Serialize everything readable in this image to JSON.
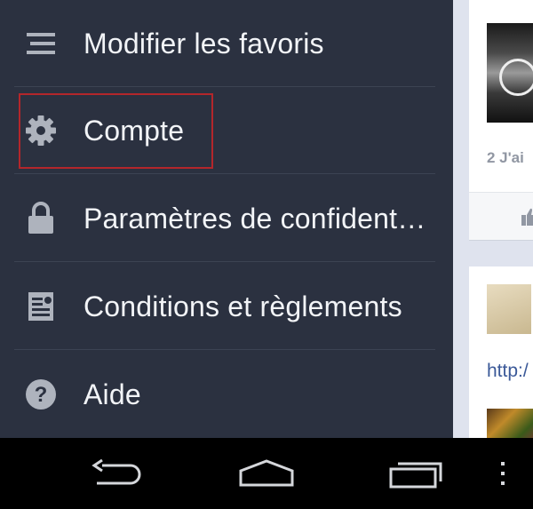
{
  "drawer": {
    "items": [
      {
        "label": "Modifier les favoris",
        "icon": "list-menu-icon"
      },
      {
        "label": "Compte",
        "icon": "gear-icon"
      },
      {
        "label": "Paramètres de confident…",
        "icon": "lock-icon"
      },
      {
        "label": "Conditions et règlements",
        "icon": "document-icon"
      },
      {
        "label": "Aide",
        "icon": "help-icon"
      }
    ]
  },
  "feed": {
    "likes_text": "2 J'ai",
    "link_text": "http:/"
  },
  "colors": {
    "drawer_bg": "#2b3140",
    "highlight": "#b3262b",
    "link": "#3b5998"
  }
}
